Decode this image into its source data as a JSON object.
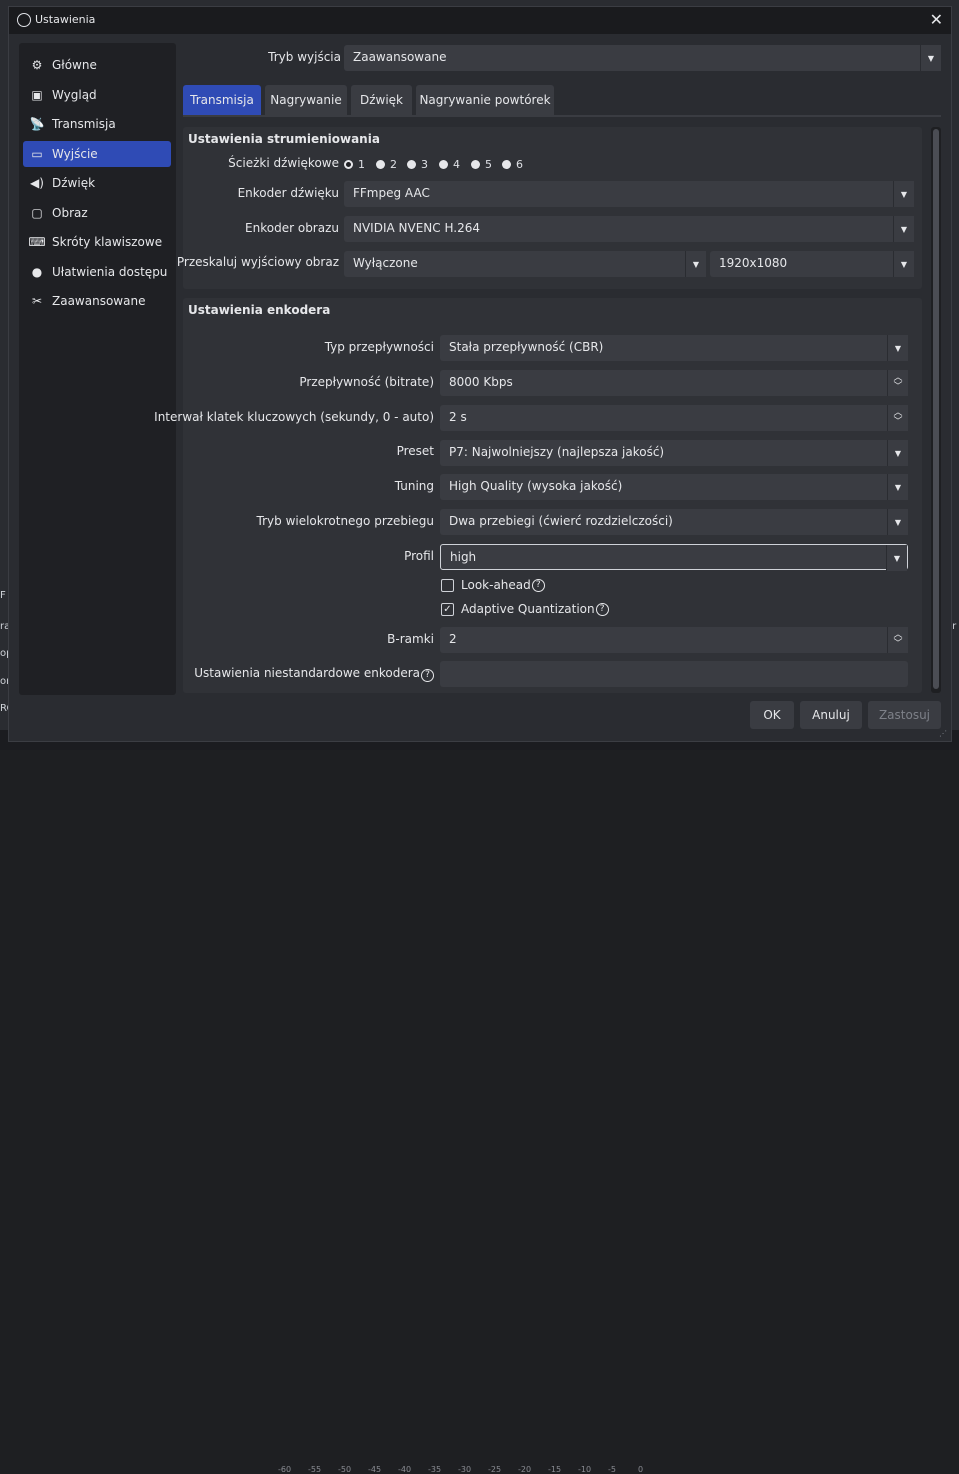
{
  "window": {
    "title": "Ustawienia"
  },
  "sidebar": {
    "items": [
      {
        "label": "Główne",
        "icon": "gear-icon"
      },
      {
        "label": "Wygląd",
        "icon": "appearance-icon"
      },
      {
        "label": "Transmisja",
        "icon": "broadcast-icon"
      },
      {
        "label": "Wyjście",
        "icon": "output-icon",
        "active": true
      },
      {
        "label": "Dźwięk",
        "icon": "speaker-icon"
      },
      {
        "label": "Obraz",
        "icon": "monitor-icon"
      },
      {
        "label": "Skróty klawiszowe",
        "icon": "keyboard-icon"
      },
      {
        "label": "Ułatwienia dostępu",
        "icon": "accessibility-icon"
      },
      {
        "label": "Zaawansowane",
        "icon": "tools-icon"
      }
    ]
  },
  "output_mode": {
    "label": "Tryb wyjścia",
    "value": "Zaawansowane"
  },
  "tabs": [
    "Transmisja",
    "Nagrywanie",
    "Dźwięk",
    "Nagrywanie powtórek"
  ],
  "stream": {
    "header": "Ustawienia strumieniowania",
    "tracks_label": "Ścieżki dźwiękowe",
    "tracks": [
      "1",
      "2",
      "3",
      "4",
      "5",
      "6"
    ],
    "audio_encoder_label": "Enkoder dźwięku",
    "audio_encoder": "FFmpeg AAC",
    "video_encoder_label": "Enkoder obrazu",
    "video_encoder": "NVIDIA NVENC H.264",
    "rescale_label": "Przeskaluj wyjściowy obraz",
    "rescale": "Wyłączone",
    "resolution": "1920x1080"
  },
  "encoder": {
    "header": "Ustawienia enkodera",
    "rate_control_label": "Typ przepływności",
    "rate_control": "Stała przepływność (CBR)",
    "bitrate_label": "Przepływność (bitrate)",
    "bitrate": "8000 Kbps",
    "keyint_label": "Interwał klatek kluczowych (sekundy, 0 - auto)",
    "keyint": "2 s",
    "preset_label": "Preset",
    "preset": "P7: Najwolniejszy (najlepsza jakość)",
    "tuning_label": "Tuning",
    "tuning": "High Quality (wysoka jakość)",
    "multipass_label": "Tryb wielokrotnego przebiegu",
    "multipass": "Dwa przebiegi (ćwierć rozdzielczości)",
    "profile_label": "Profil",
    "profile": "high",
    "lookahead_label": "Look-ahead",
    "aq_label": "Adaptive Quantization",
    "bframes_label": "B-ramki",
    "bframes": "2",
    "custom_label": "Ustawienia niestandardowe enkodera",
    "custom": ""
  },
  "buttons": {
    "ok": "OK",
    "cancel": "Anuluj",
    "apply": "Zastosuj"
  },
  "background": {
    "meter_ticks": [
      "-60",
      "-55",
      "-50",
      "-45",
      "-40",
      "-35",
      "-30",
      "-25",
      "-20",
      "-15",
      "-10",
      "-5",
      "0"
    ]
  }
}
